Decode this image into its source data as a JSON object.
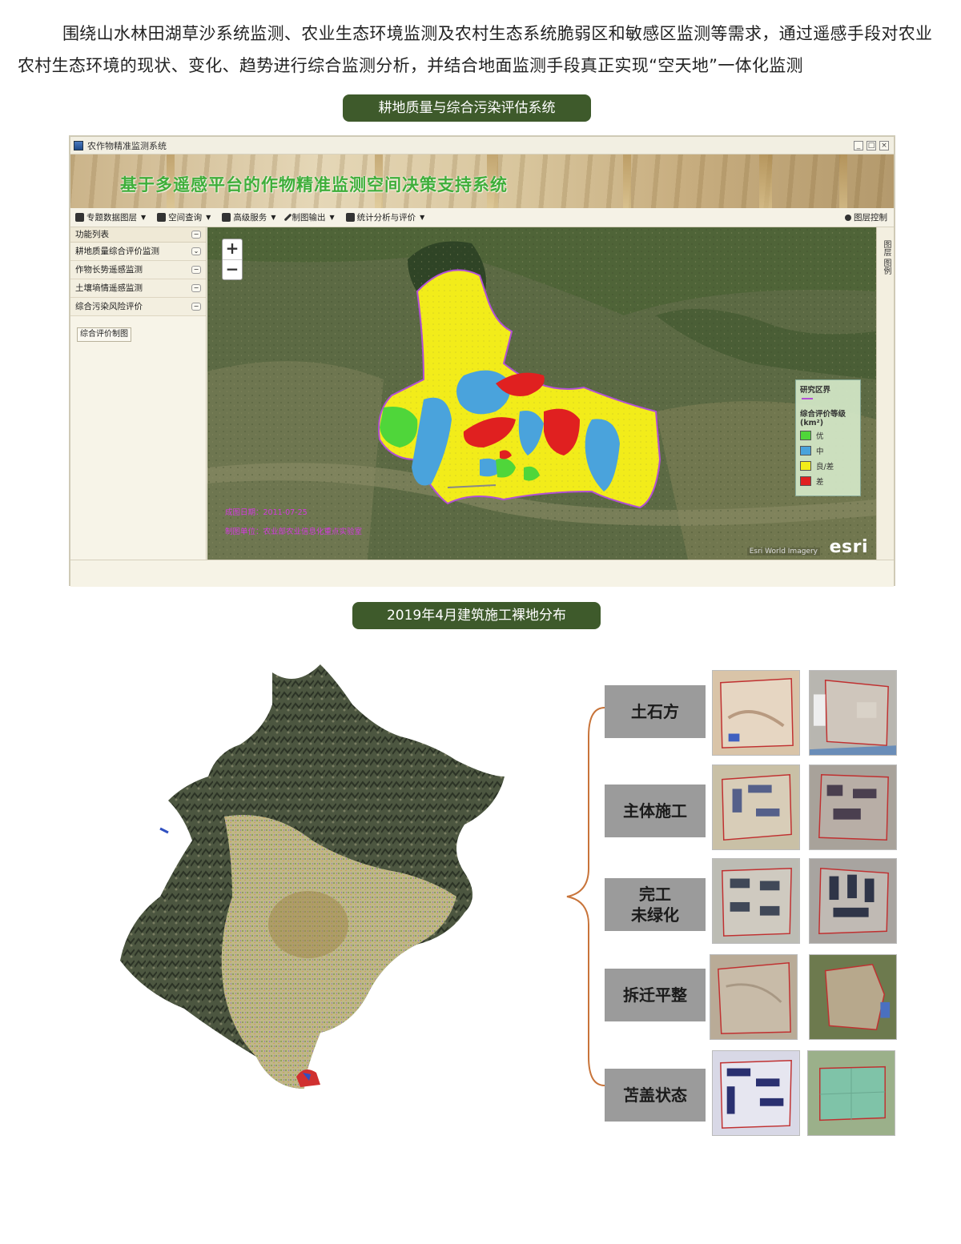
{
  "intro_text": "围绕山水林田湖草沙系统监测、农业生态环境监测及农村生态系统脆弱区和敏感区监测等需求，通过遥感手段对农业农村生态环境的现状、变化、趋势进行综合监测分析，并结合地面监测手段真正实现“空天地”一体化监测",
  "section1_label": "耕地质量与综合污染评估系统",
  "section2_label": "2019年4月建筑施工裸地分布",
  "app": {
    "window_title": "农作物精准监测系统",
    "banner_title": "基于多遥感平台的作物精准监测空间决策支持系统",
    "toolbar": [
      {
        "label": "专题数据图层",
        "icon": "layers-icon"
      },
      {
        "label": "空间查询",
        "icon": "query-icon"
      },
      {
        "label": "高级服务",
        "icon": "service-icon"
      },
      {
        "label": "制图输出",
        "icon": "pen-icon"
      },
      {
        "label": "统计分析与评价",
        "icon": "chart-icon"
      }
    ],
    "toolbar_right": "图层控制",
    "sidebar": {
      "header": "功能列表",
      "items": [
        "耕地质量综合评价监测",
        "作物长势遥感监测",
        "土壤墒情遥感监测",
        "综合污染风险评价"
      ],
      "button": "综合评价制图"
    },
    "right_panel": "图层 图例",
    "zoom_in": "+",
    "zoom_out": "−",
    "legend": {
      "title": "研究区界",
      "subtitle": "综合评价等级(km²)",
      "items": [
        {
          "label": "优",
          "color": "#4fd63a"
        },
        {
          "label": "中",
          "color": "#4aa3dc"
        },
        {
          "label": "良/差",
          "color": "#f2ec1a"
        },
        {
          "label": "差",
          "color": "#e02020"
        }
      ],
      "boundary_color": "#b24fd6"
    },
    "map_notes": [
      "成图日期：2011-07-25",
      "制图单位：农业部农业信息化重点实验室"
    ],
    "attribution": "Esri World Imagery",
    "esri_logo": "esri"
  },
  "categories": [
    "土石方",
    "主体施工",
    "完工\n未绿化",
    "拆迁平整",
    "苫盖状态"
  ],
  "colors": {
    "pill_bg": "#3e5a2b",
    "brace": "#c8743a",
    "category_bg": "#9b9b9b"
  }
}
